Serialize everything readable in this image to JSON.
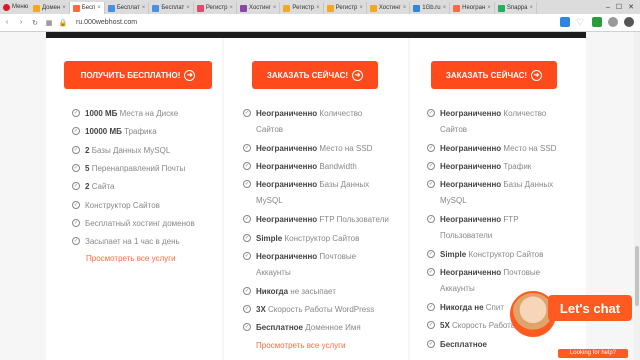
{
  "browser": {
    "menu_label": "Меню",
    "tabs": [
      {
        "label": "Домен",
        "color": "#f5a623"
      },
      {
        "label": "Бесп",
        "color": "#ff6a3d",
        "active": true
      },
      {
        "label": "Бесплат",
        "color": "#4a90e2"
      },
      {
        "label": "Бесплат",
        "color": "#4a90e2"
      },
      {
        "label": "Регистр",
        "color": "#e24a6a"
      },
      {
        "label": "Хостинг",
        "color": "#8e44ad"
      },
      {
        "label": "Регистр",
        "color": "#f5a623"
      },
      {
        "label": "Регистр",
        "color": "#f5a623"
      },
      {
        "label": "Хостинг",
        "color": "#f5a623"
      },
      {
        "label": "1Gb.ru",
        "color": "#2e86de"
      },
      {
        "label": "Неогран",
        "color": "#ff6a3d"
      },
      {
        "label": "Snappa",
        "color": "#27ae60"
      }
    ],
    "url": "ru.000webhost.com"
  },
  "plans": [
    {
      "button_label": "ПОЛУЧИТЬ БЕСПЛАТНО!",
      "features": [
        {
          "bold": "1000 МБ",
          "text": "Места на Диске"
        },
        {
          "bold": "10000 МБ",
          "text": "Трафика"
        },
        {
          "bold": "2",
          "text": "Базы Данных MySQL"
        },
        {
          "bold": "5",
          "text": "Перенаправлений Почты"
        },
        {
          "bold": "2",
          "text": "Сайта"
        },
        {
          "bold": "",
          "text": "Конструктор Сайтов"
        },
        {
          "bold": "",
          "text": "Бесплатный хостинг доменов"
        },
        {
          "bold": "",
          "text": "Засыпает на 1 час в день"
        }
      ],
      "link": "Просмотреть все услуги"
    },
    {
      "button_label": "ЗАКАЗАТЬ СЕЙЧАС!",
      "features": [
        {
          "bold": "Неограниченно",
          "text": "Количество",
          "text2": "Сайтов"
        },
        {
          "bold": "Неограниченно",
          "text": "Место на SSD"
        },
        {
          "bold": "Неограниченно",
          "text": "Bandwidth"
        },
        {
          "bold": "Неограниченно",
          "text": "Базы Данных",
          "text2": "MySQL"
        },
        {
          "bold": "Неограниченно",
          "text": "FTP Пользователи"
        },
        {
          "bold": "Simple",
          "text": "Конструктор Сайтов"
        },
        {
          "bold": "Неограниченно",
          "text": "Почтовые",
          "text2": "Аккаунты"
        },
        {
          "bold": "Никогда",
          "text": "не засыпает"
        },
        {
          "bold": "3X",
          "text": "Скорость Работы WordPress"
        },
        {
          "bold": "Бесплатное",
          "text": "Доменное Имя"
        }
      ],
      "link": "Просмотреть все услуги"
    },
    {
      "button_label": "ЗАКАЗАТЬ СЕЙЧАС!",
      "features": [
        {
          "bold": "Неограниченно",
          "text": "Количество",
          "text2": "Сайтов"
        },
        {
          "bold": "Неограниченно",
          "text": "Место на SSD"
        },
        {
          "bold": "Неограниченно",
          "text": "Трафик"
        },
        {
          "bold": "Неограниченно",
          "text": "Базы Данных",
          "text2": "MySQL"
        },
        {
          "bold": "Неограниченно",
          "text": "FTP",
          "text2": "Пользователи"
        },
        {
          "bold": "Simple",
          "text": "Конструктор Сайтов"
        },
        {
          "bold": "Неограниченно",
          "text": "Почтовые",
          "text2": "Аккаунты"
        },
        {
          "bold": "Никогда не",
          "text": "Спит"
        },
        {
          "bold": "5X",
          "text": "Скорость Работы"
        },
        {
          "bold": "Бесплатное",
          "text": ""
        }
      ]
    }
  ],
  "chat": {
    "title": "Let's chat",
    "subtitle": "Looking for help?"
  }
}
